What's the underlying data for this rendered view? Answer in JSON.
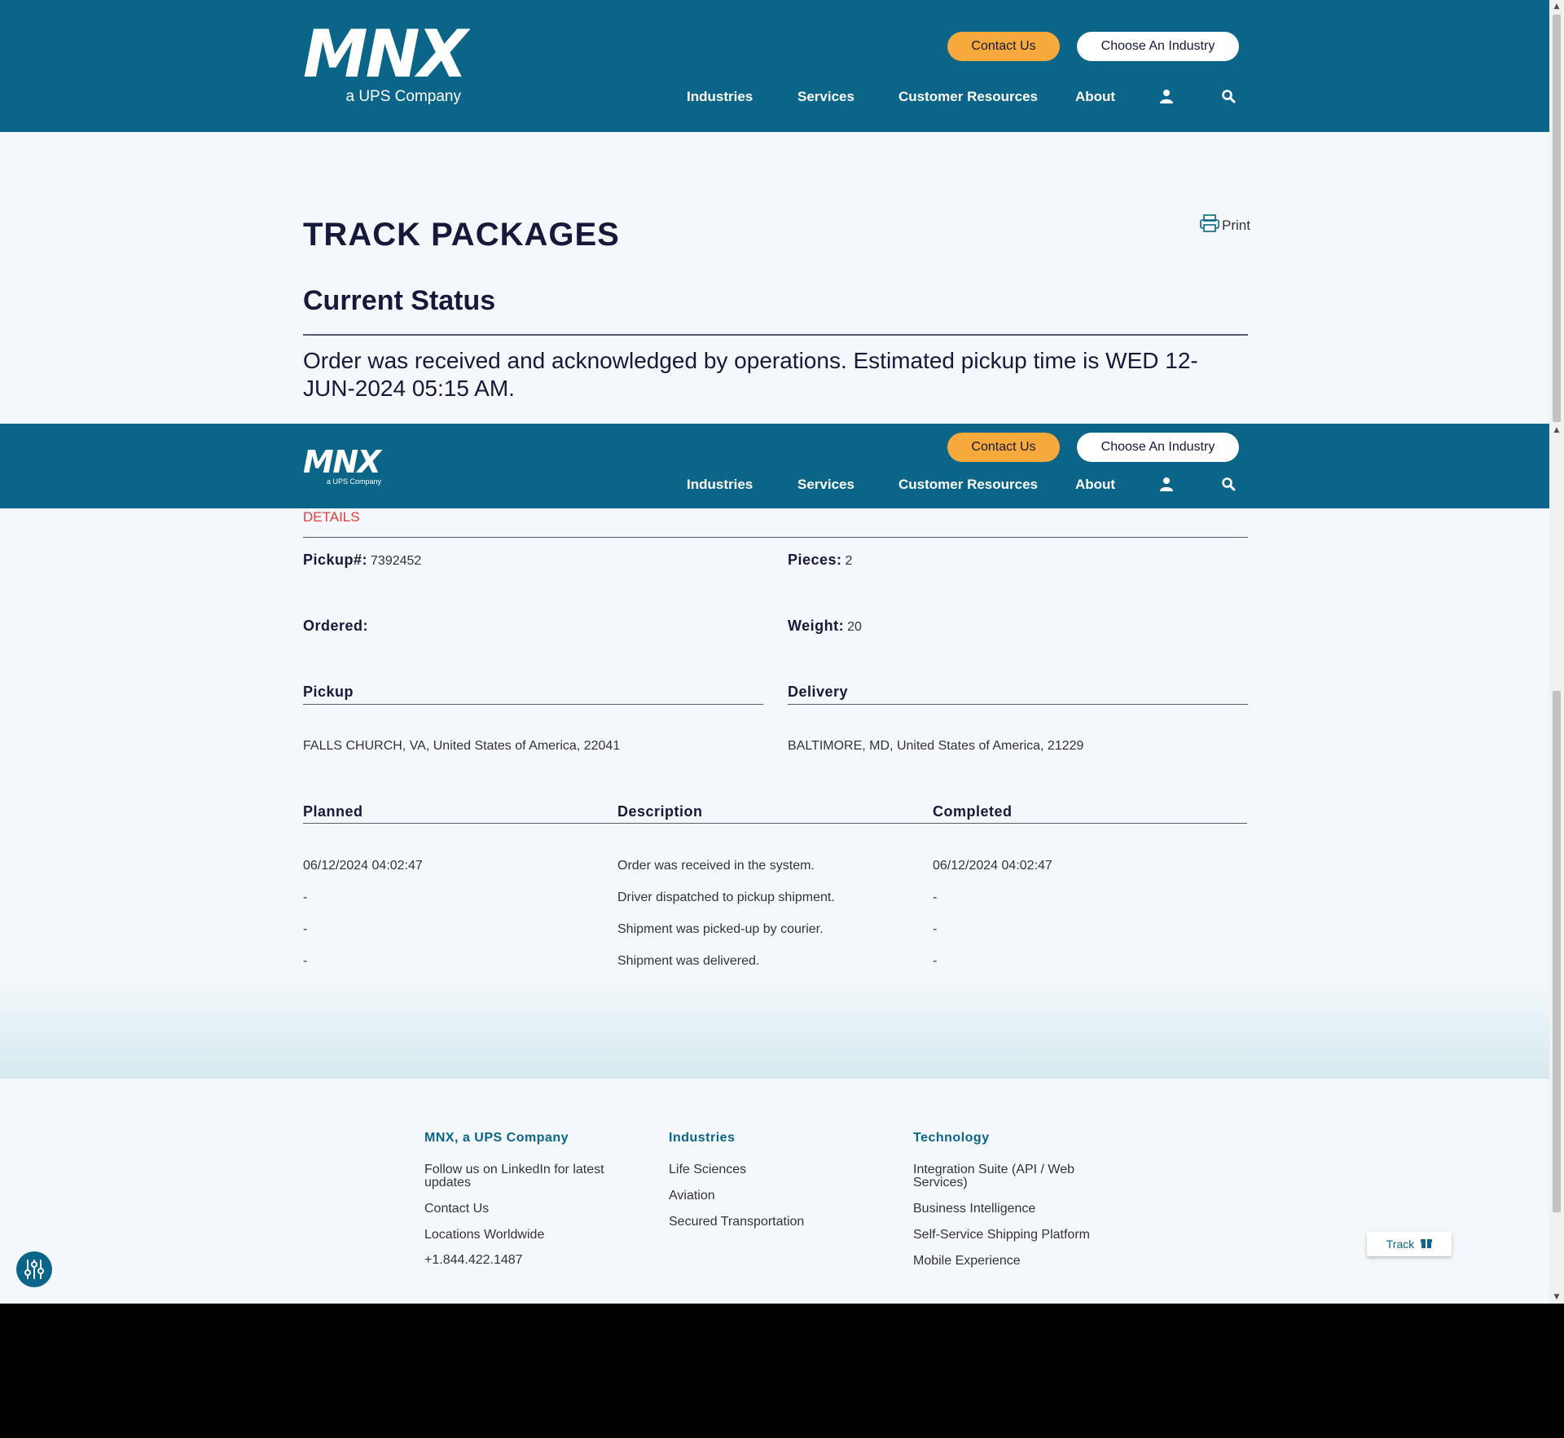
{
  "brand": {
    "logo_text": "MNX",
    "logo_sub": "a UPS Company"
  },
  "header": {
    "contact_label": "Contact Us",
    "industry_label": "Choose An Industry",
    "nav": [
      "Industries",
      "Services",
      "Customer Resources",
      "About"
    ],
    "account_icon": "user-icon",
    "search_icon": "search-icon"
  },
  "page": {
    "title": "TRACK PACKAGES",
    "print_label": "Print",
    "status_heading": "Current Status",
    "status_text": "Order was received and acknowledged by operations. Estimated pickup time is WED 12-JUN-2024 05:15 AM."
  },
  "details": {
    "section_label": "DETAILS",
    "pickup_no_label": "Pickup#:",
    "pickup_no": "7392452",
    "pieces_label": "Pieces:",
    "pieces": "2",
    "ordered_label": "Ordered:",
    "ordered": "",
    "weight_label": "Weight:",
    "weight": "20",
    "pickup_heading": "Pickup",
    "pickup_address": "FALLS CHURCH, VA, United States of America, 22041",
    "delivery_heading": "Delivery",
    "delivery_address": "BALTIMORE, MD, United States of America, 21229"
  },
  "history": {
    "columns": [
      "Planned",
      "Description",
      "Completed"
    ],
    "rows": [
      {
        "planned": "06/12/2024 04:02:47",
        "description": "Order was received in the system.",
        "completed": "06/12/2024 04:02:47"
      },
      {
        "planned": "-",
        "description": "Driver dispatched to pickup shipment.",
        "completed": "-"
      },
      {
        "planned": "-",
        "description": "Shipment was picked-up by courier.",
        "completed": "-"
      },
      {
        "planned": "-",
        "description": "Shipment was delivered.",
        "completed": "-"
      }
    ]
  },
  "footer": {
    "columns": [
      {
        "heading": "MNX, a UPS Company",
        "links": [
          "Follow us on LinkedIn for latest updates",
          "Contact Us",
          "Locations Worldwide",
          "+1.844.422.1487"
        ]
      },
      {
        "heading": "Industries",
        "links": [
          "Life Sciences",
          "Aviation",
          "Secured Transportation"
        ]
      },
      {
        "heading": "Technology",
        "links": [
          "Integration Suite (API / Web Services)",
          "Business Intelligence",
          "Self-Service Shipping Platform",
          "Mobile Experience"
        ]
      }
    ]
  },
  "widgets": {
    "track_label": "Track",
    "accessibility_icon": "accessibility-sliders-icon",
    "track_icon": "package-icon"
  },
  "colors": {
    "brand_blue": "#0a6589",
    "accent_orange": "#f7a93b",
    "details_red": "#e43c3c"
  }
}
